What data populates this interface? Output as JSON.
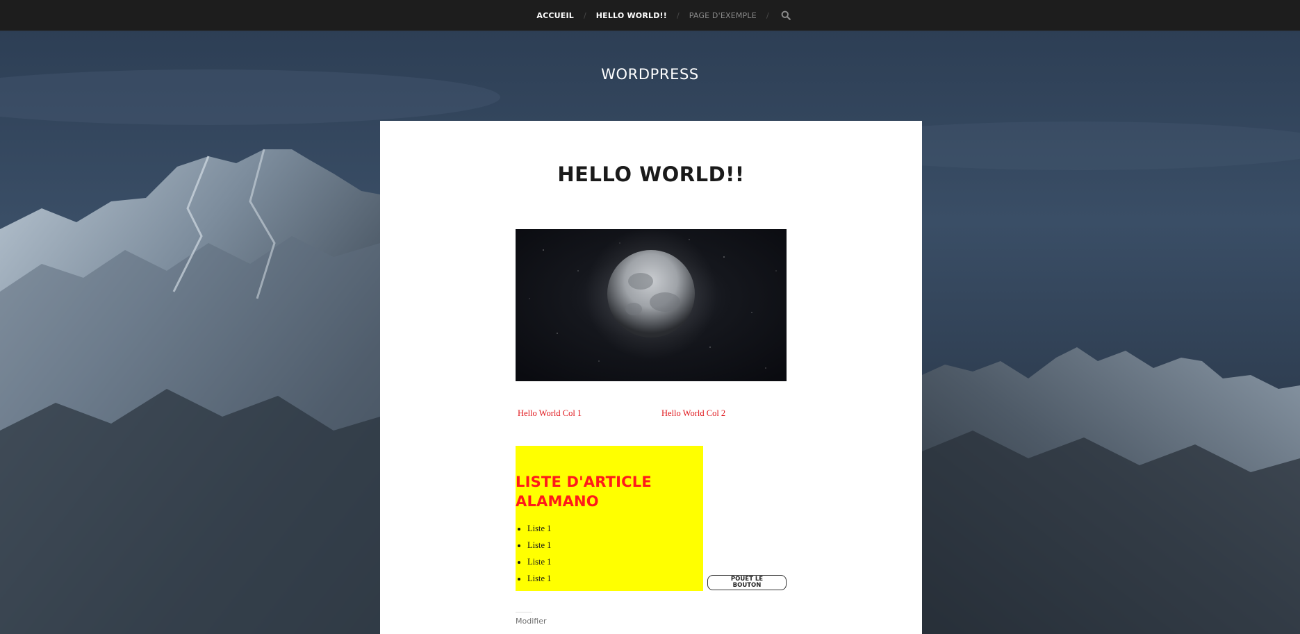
{
  "nav": {
    "items": [
      {
        "label": "ACCUEIL"
      },
      {
        "label": "HELLO WORLD!!"
      },
      {
        "label": "PAGE D'EXEMPLE"
      }
    ],
    "separator": "/",
    "search_icon": "search-icon"
  },
  "site": {
    "title": "WORDPRESS"
  },
  "post": {
    "title": "HELLO WORLD!!",
    "image_icon": "moon-image",
    "col1": "Hello World Col 1",
    "col2": "Hello World Col 2",
    "box": {
      "title": "LISTE D'ARTICLE ALAMANO",
      "items": [
        "Liste 1",
        "Liste 1",
        "Liste 1",
        "Liste 1"
      ]
    },
    "button_label": "POUET LE BOUTON",
    "edit_label": "Modifier"
  },
  "colors": {
    "nav_bg": "#1d1d1d",
    "box_bg": "#ffff00",
    "box_title": "#ff1a1a",
    "col_text": "#e0161b"
  }
}
